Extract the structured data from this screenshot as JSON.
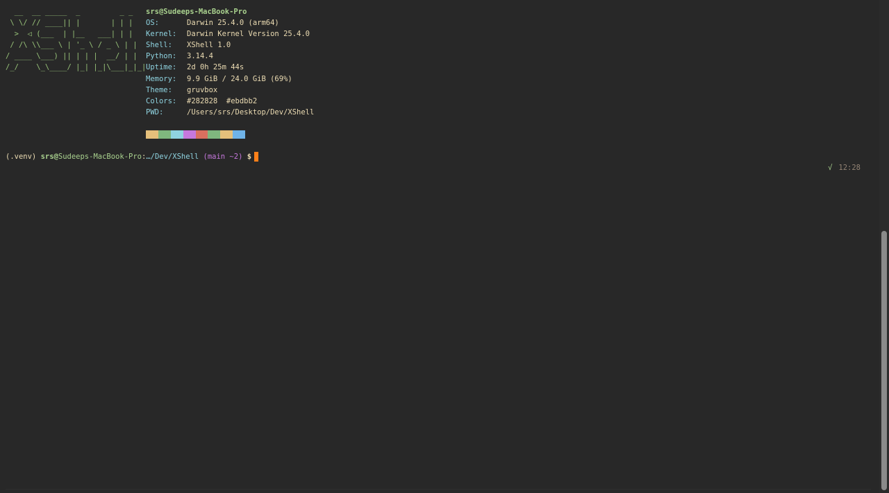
{
  "ascii_logo": "  __  __ _____  _         _ _ \n \\ \\/ // ____|| |       | | |\n  >  ◁ (___  | |__   ___| | |\n / /\\ \\\\___ \\ | '_ \\ / _ \\ | |\n/ ____ \\___) || | | |  __/ | |\n/_/    \\_\\____/ |_| |_|\\___|_|_|",
  "info": {
    "title": "srs@Sudeeps-MacBook-Pro",
    "rows": [
      {
        "key": "OS:",
        "value": "Darwin 25.4.0 (arm64)"
      },
      {
        "key": "Kernel:",
        "value": "Darwin Kernel Version 25.4.0"
      },
      {
        "key": "Shell:",
        "value": "XShell 1.0"
      },
      {
        "key": "Python:",
        "value": "3.14.4"
      },
      {
        "key": "Uptime:",
        "value": "2d 0h 25m 44s"
      },
      {
        "key": "Memory:",
        "value": "9.9 GiB / 24.0 GiB (69%)"
      },
      {
        "key": "Theme:",
        "value": "gruvbox"
      },
      {
        "key": "Colors:",
        "value": "#282828  #ebdbb2"
      },
      {
        "key": "PWD:",
        "value": "/Users/srs/Desktop/Dev/XShell"
      }
    ]
  },
  "swatch_colors": [
    "#e5c07b",
    "#7fb77e",
    "#8fd3e0",
    "#c678dd",
    "#d9705f",
    "#7fb77e",
    "#e5c07b",
    "#6fb3e8"
  ],
  "prompt": {
    "venv": "(.venv) ",
    "user": "srs",
    "at": "@",
    "host": "Sudeeps-MacBook-Pro",
    "sep": ":",
    "path": "…/Dev/XShell",
    "git": " (main ~2)",
    "dollar": " $"
  },
  "status": {
    "check": "√",
    "time": "12:28"
  },
  "colors": {
    "background": "#282828",
    "foreground": "#ebdbb2",
    "cursor": "#fe8019"
  }
}
